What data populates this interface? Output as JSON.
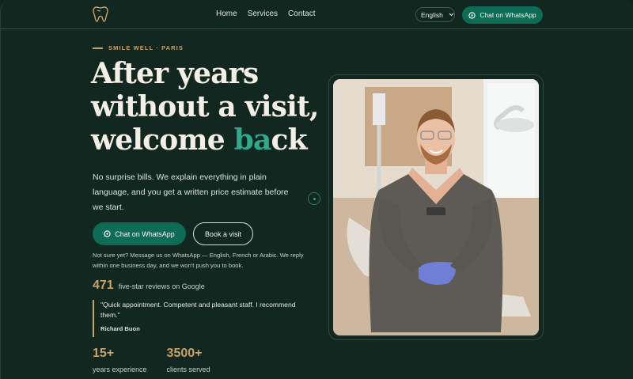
{
  "nav": {
    "links": [
      "Home",
      "Services",
      "Contact"
    ],
    "language": "English",
    "whatsapp_label": "Chat on WhatsApp"
  },
  "hero": {
    "eyebrow": "SMILE WELL · PARIS",
    "headline_line1": "After years",
    "headline_line2": "without a visit,",
    "headline_line3_pre": "welcome ",
    "headline_accent": "ba",
    "headline_line3_post": "ck",
    "lede": "No surprise bills. We explain everything in plain language, and you get a written price estimate before we start.",
    "primary_cta": "Chat on WhatsApp",
    "secondary_cta": "Book a visit",
    "note": "Not sure yet? Message us on WhatsApp — English, French or Arabic. We reply within one business day, and we won't push you to book."
  },
  "reviews": {
    "count": "471",
    "label": "five-star reviews on Google",
    "quote": "\"Quick appointment. Competent and pleasant staff. I recommend them.\"",
    "author": "Richard Buon"
  },
  "stats": [
    {
      "value": "15+",
      "label": "years experience"
    },
    {
      "value": "3500+",
      "label": "clients served"
    }
  ],
  "colors": {
    "background": "#11271f",
    "brand_green": "#0e6b56",
    "accent_gold": "#c9a26a",
    "accent_teal": "#2fa88c"
  },
  "icons": [
    "tooth-logo-icon",
    "chevron-down-icon",
    "whatsapp-icon"
  ]
}
